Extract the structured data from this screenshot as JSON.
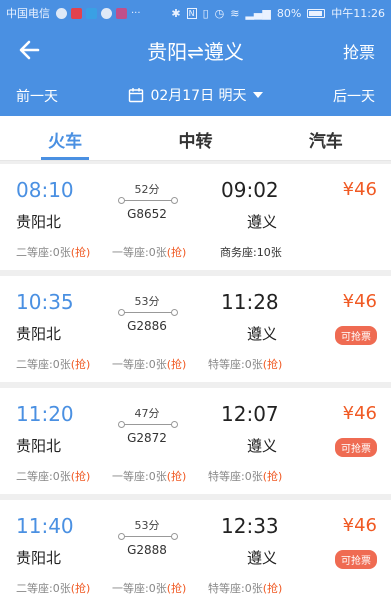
{
  "status_bar": {
    "carrier": "中国电信",
    "battery": "80%",
    "time": "中午11:26"
  },
  "header": {
    "title": "贵阳⇌遵义",
    "action": "抢票"
  },
  "date_bar": {
    "prev": "前一天",
    "date": "02月17日 明天",
    "next": "后一天"
  },
  "tabs": [
    {
      "label": "火车",
      "active": true
    },
    {
      "label": "中转",
      "active": false
    },
    {
      "label": "汽车",
      "active": false
    }
  ],
  "trains": [
    {
      "dep_time": "08:10",
      "dep_station": "贵阳北",
      "duration": "52分",
      "train_no": "G8652",
      "arr_time": "09:02",
      "arr_station": "遵义",
      "price": "¥46",
      "badge": "",
      "seats": [
        {
          "name": "二等座:0张",
          "tag": "(抢)"
        },
        {
          "name": "一等座:0张",
          "tag": "(抢)"
        },
        {
          "name": "商务座:10张",
          "tag": ""
        }
      ]
    },
    {
      "dep_time": "10:35",
      "dep_station": "贵阳北",
      "duration": "53分",
      "train_no": "G2886",
      "arr_time": "11:28",
      "arr_station": "遵义",
      "price": "¥46",
      "badge": "可抢票",
      "seats": [
        {
          "name": "二等座:0张",
          "tag": "(抢)"
        },
        {
          "name": "一等座:0张",
          "tag": "(抢)"
        },
        {
          "name": "特等座:0张",
          "tag": "(抢)"
        }
      ]
    },
    {
      "dep_time": "11:20",
      "dep_station": "贵阳北",
      "duration": "47分",
      "train_no": "G2872",
      "arr_time": "12:07",
      "arr_station": "遵义",
      "price": "¥46",
      "badge": "可抢票",
      "seats": [
        {
          "name": "二等座:0张",
          "tag": "(抢)"
        },
        {
          "name": "一等座:0张",
          "tag": "(抢)"
        },
        {
          "name": "特等座:0张",
          "tag": "(抢)"
        }
      ]
    },
    {
      "dep_time": "11:40",
      "dep_station": "贵阳北",
      "duration": "53分",
      "train_no": "G2888",
      "arr_time": "12:33",
      "arr_station": "遵义",
      "price": "¥46",
      "badge": "可抢票",
      "seats": [
        {
          "name": "二等座:0张",
          "tag": "(抢)"
        },
        {
          "name": "一等座:0张",
          "tag": "(抢)"
        },
        {
          "name": "特等座:0张",
          "tag": "(抢)"
        }
      ]
    }
  ],
  "colors": {
    "primary": "#4a90e2",
    "price": "#f05a24",
    "badge": "#ef6b52"
  }
}
